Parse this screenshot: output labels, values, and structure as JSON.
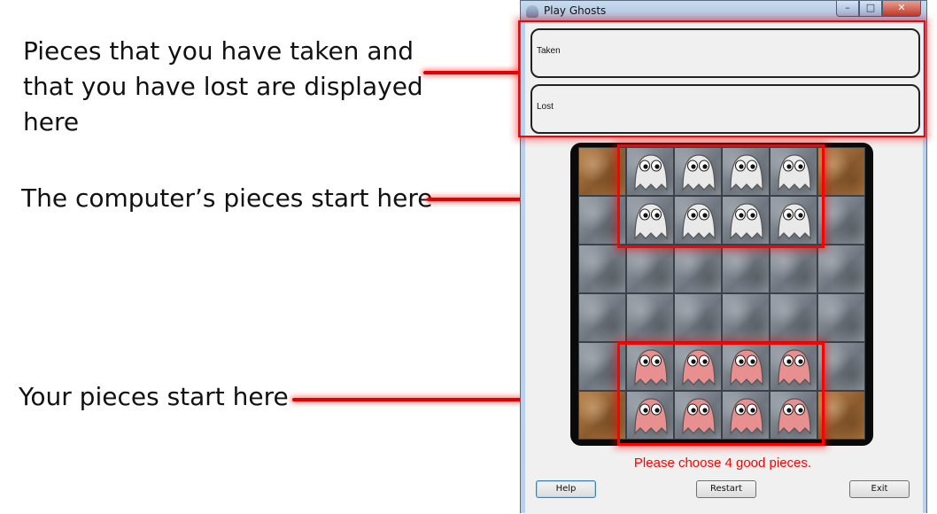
{
  "annotations": {
    "panels": "Pieces that you have taken and\nthat you have lost are displayed\nhere",
    "computer": "The computer’s pieces start here",
    "yours": "Your pieces start here"
  },
  "window": {
    "title": "Play Ghosts",
    "caption_min": "–",
    "caption_max": "□",
    "caption_close": "✕"
  },
  "panels": {
    "taken_label": "Taken",
    "lost_label": "Lost"
  },
  "board": {
    "rows": [
      [
        "exit",
        "computer",
        "computer",
        "computer",
        "computer",
        "exit"
      ],
      [
        "empty",
        "computer",
        "computer",
        "computer",
        "computer",
        "empty"
      ],
      [
        "empty",
        "empty",
        "empty",
        "empty",
        "empty",
        "empty"
      ],
      [
        "empty",
        "empty",
        "empty",
        "empty",
        "empty",
        "empty"
      ],
      [
        "empty",
        "player",
        "player",
        "player",
        "player",
        "empty"
      ],
      [
        "exit",
        "player",
        "player",
        "player",
        "player",
        "exit"
      ]
    ],
    "colors": {
      "computer_ghost": "#e9e9e9",
      "player_ghost": "#e88f8f",
      "highlight": "#ff0000"
    }
  },
  "status": "Please choose 4 good pieces.",
  "buttons": {
    "help": "Help",
    "restart": "Restart",
    "exit": "Exit"
  }
}
